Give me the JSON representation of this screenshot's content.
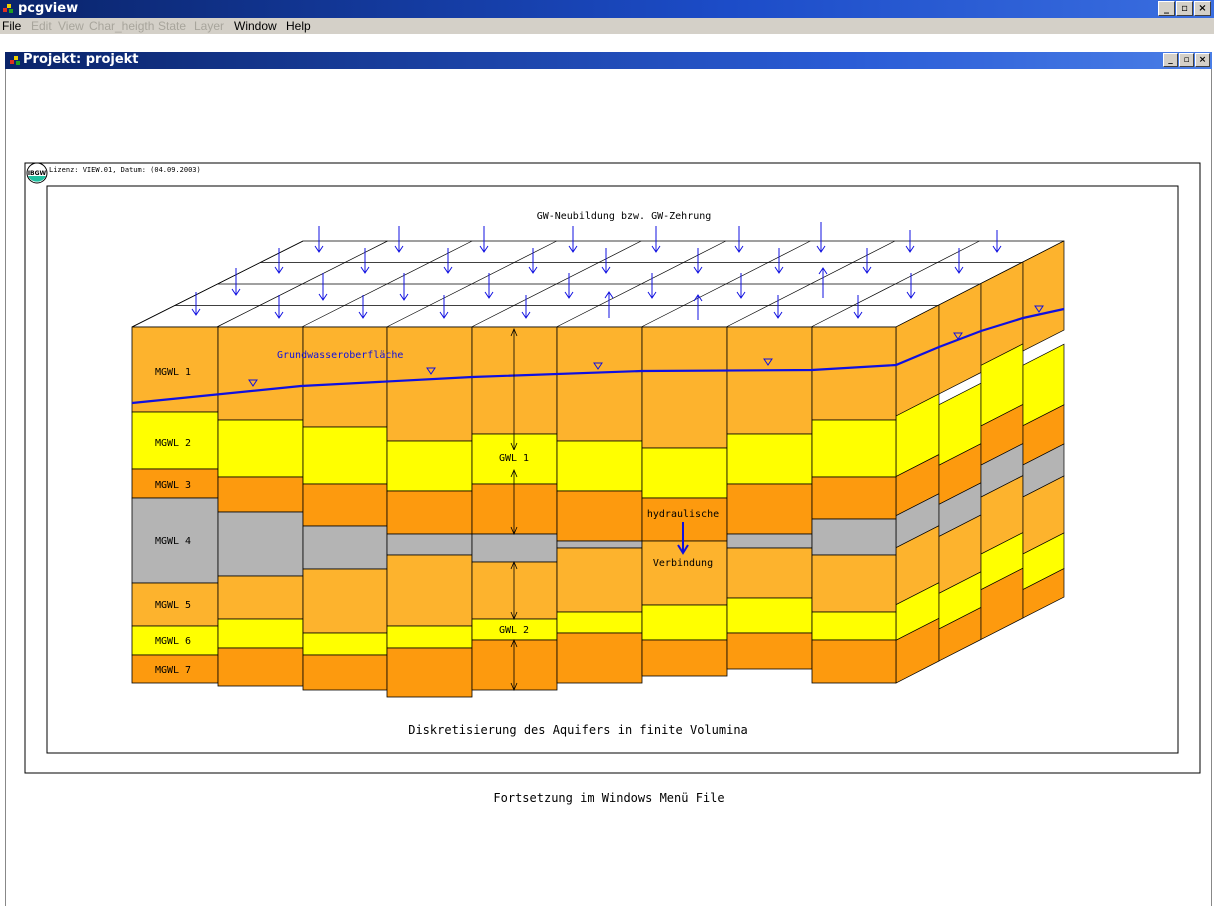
{
  "app": {
    "title": "pcgview"
  },
  "menu": {
    "items": [
      {
        "label": "File",
        "enabled": true
      },
      {
        "label": "Edit",
        "enabled": false
      },
      {
        "label": "View",
        "enabled": false
      },
      {
        "label": "Char_heigth",
        "enabled": false
      },
      {
        "label": "State",
        "enabled": false
      },
      {
        "label": "Layer",
        "enabled": false
      },
      {
        "label": "Window",
        "enabled": true
      },
      {
        "label": "Help",
        "enabled": true
      }
    ]
  },
  "window_buttons": {
    "minimize": "_",
    "restore": "▫",
    "close": "×"
  },
  "child": {
    "title": "Projekt: projekt"
  },
  "drawing": {
    "license": "Lizenz: VIEW.01, Datum: (04.09.2003)",
    "logo_text": "IBGW",
    "heading": "GW-Neubildung bzw. GW-Zehrung",
    "surface_label": "Grundwasseroberfläche",
    "layers": [
      "MGWL 1",
      "MGWL 2",
      "MGWL 3",
      "MGWL 4",
      "MGWL 5",
      "MGWL 6",
      "MGWL 7"
    ],
    "gwl1": "GWL 1",
    "gwl2": "GWL 2",
    "hydraulic_1": "hydraulische",
    "hydraulic_2": "Verbindung",
    "caption": "Diskretisierung des Aquifers in finite Volumina",
    "footer": "Fortsetzung im Windows Menü File"
  },
  "colors": {
    "orange_light": "#fdb32d",
    "yellow": "#ffff00",
    "orange_dark": "#fd9a0e",
    "gray": "#b4b4b4",
    "blue": "#1010e0",
    "titlebar": "#0a246a"
  }
}
